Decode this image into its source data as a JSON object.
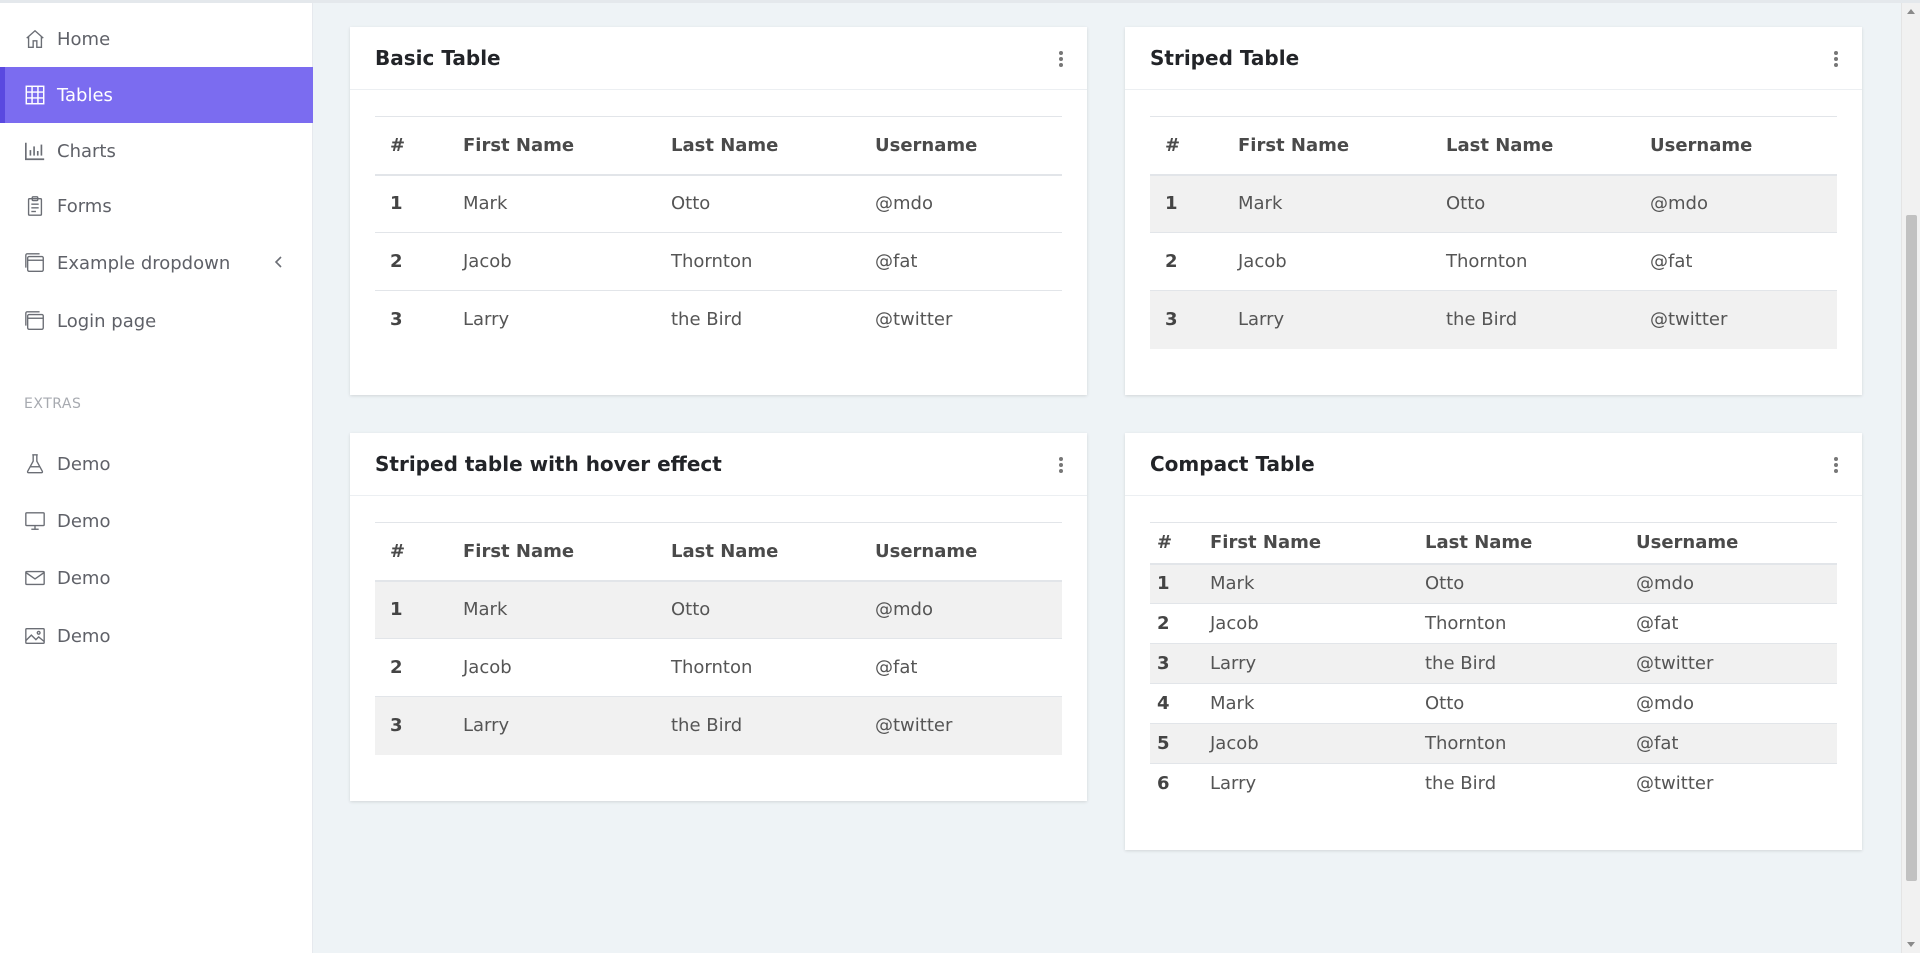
{
  "sidebar": {
    "items": [
      {
        "label": "Home",
        "icon": "home-icon"
      },
      {
        "label": "Tables",
        "icon": "grid-icon",
        "active": true
      },
      {
        "label": "Charts",
        "icon": "bar-chart-icon"
      },
      {
        "label": "Forms",
        "icon": "clipboard-icon"
      },
      {
        "label": "Example dropdown",
        "icon": "window-icon"
      },
      {
        "label": "Login page",
        "icon": "window-icon"
      }
    ],
    "extras_heading": "EXTRAS",
    "extras": [
      {
        "label": "Demo",
        "icon": "flask-icon"
      },
      {
        "label": "Demo",
        "icon": "monitor-icon"
      },
      {
        "label": "Demo",
        "icon": "envelope-icon"
      },
      {
        "label": "Demo",
        "icon": "image-icon"
      }
    ]
  },
  "tables": {
    "columns": [
      "#",
      "First Name",
      "Last Name",
      "Username"
    ],
    "basic": {
      "title": "Basic Table",
      "rows": [
        [
          "1",
          "Mark",
          "Otto",
          "@mdo"
        ],
        [
          "2",
          "Jacob",
          "Thornton",
          "@fat"
        ],
        [
          "3",
          "Larry",
          "the Bird",
          "@twitter"
        ]
      ]
    },
    "striped": {
      "title": "Striped Table",
      "rows": [
        [
          "1",
          "Mark",
          "Otto",
          "@mdo"
        ],
        [
          "2",
          "Jacob",
          "Thornton",
          "@fat"
        ],
        [
          "3",
          "Larry",
          "the Bird",
          "@twitter"
        ]
      ]
    },
    "hover": {
      "title": "Striped table with hover effect",
      "rows": [
        [
          "1",
          "Mark",
          "Otto",
          "@mdo"
        ],
        [
          "2",
          "Jacob",
          "Thornton",
          "@fat"
        ],
        [
          "3",
          "Larry",
          "the Bird",
          "@twitter"
        ]
      ]
    },
    "compact": {
      "title": "Compact Table",
      "rows": [
        [
          "1",
          "Mark",
          "Otto",
          "@mdo"
        ],
        [
          "2",
          "Jacob",
          "Thornton",
          "@fat"
        ],
        [
          "3",
          "Larry",
          "the Bird",
          "@twitter"
        ],
        [
          "4",
          "Mark",
          "Otto",
          "@mdo"
        ],
        [
          "5",
          "Jacob",
          "Thornton",
          "@fat"
        ],
        [
          "6",
          "Larry",
          "the Bird",
          "@twitter"
        ]
      ]
    }
  },
  "colors": {
    "accent": "#7b6cf0",
    "background": "#eef3f6"
  }
}
